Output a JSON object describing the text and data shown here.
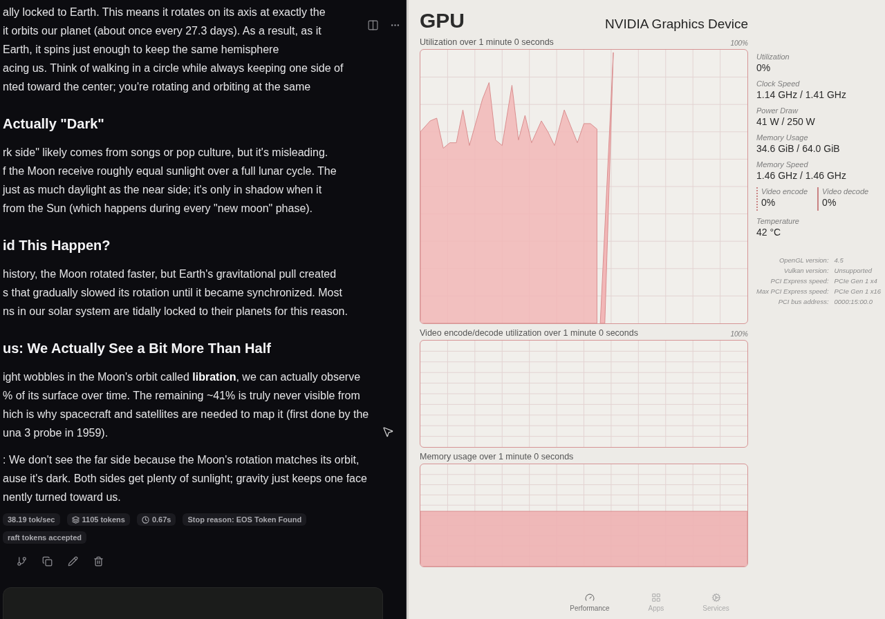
{
  "chat": {
    "blocks": [
      {
        "kind": "paragraph",
        "lines": [
          "ally locked to Earth. This means it rotates on its axis at exactly the",
          "it orbits our planet (about once every 27.3 days). As a result, as it",
          "Earth, it spins just enough to keep the same hemisphere",
          "acing us. Think of walking in a circle while always keeping one side of",
          "nted toward the center; you're rotating and orbiting at the same"
        ]
      },
      {
        "kind": "heading",
        "text": "Actually \"Dark\""
      },
      {
        "kind": "paragraph",
        "lines": [
          "rk side\" likely comes from songs or pop culture, but it's misleading.",
          "f the Moon receive roughly equal sunlight over a full lunar cycle. The",
          "just as much daylight as the near side; it's only in shadow when it",
          "from the Sun (which happens during every \"new moon\" phase)."
        ]
      },
      {
        "kind": "heading",
        "text": "id This Happen?"
      },
      {
        "kind": "paragraph",
        "lines": [
          "history, the Moon rotated faster, but Earth's gravitational pull created",
          "s that gradually slowed its rotation until it became synchronized. Most",
          "ns in our solar system are tidally locked to their planets for this reason."
        ]
      },
      {
        "kind": "heading",
        "text": "us: We Actually See a Bit More Than Half"
      },
      {
        "kind": "paragraph",
        "lines": [
          "ight wobbles in the Moon's orbit called **libration**, we can actually observe",
          "% of its surface over time. The remaining ~41% is truly never visible from",
          "hich is why spacecraft and satellites are needed to map it (first done by the",
          "una 3 probe in 1959)."
        ]
      },
      {
        "kind": "paragraph",
        "lines": [
          ": We don't see the far side because the Moon's rotation matches its orbit,",
          "ause it's dark. Both sides get plenty of sunlight; gravity just keeps one face",
          "nently turned toward us."
        ]
      }
    ],
    "stats": [
      {
        "kind": "speed",
        "text": "38.19 tok/sec"
      },
      {
        "kind": "tokens",
        "text": "1105 tokens"
      },
      {
        "kind": "time",
        "text": "0.67s"
      },
      {
        "kind": "stop",
        "text": "Stop reason: EOS Token Found"
      },
      {
        "kind": "draft",
        "text": "raft tokens accepted"
      }
    ]
  },
  "monitor": {
    "title": "GPU",
    "device": "NVIDIA Graphics Device",
    "charts": [
      {
        "kind": "utilization",
        "title": "Utilization over 1 minute 0 seconds",
        "max_label": "100%"
      },
      {
        "kind": "encode",
        "title": "Video encode/decode utilization over 1 minute 0 seconds",
        "max_label": "100%"
      },
      {
        "kind": "memory",
        "title": "Memory usage over 1 minute 0 seconds"
      }
    ],
    "stats": [
      {
        "label": "Utilization",
        "value": "0%"
      },
      {
        "label": "Clock Speed",
        "value": "1.14 GHz / 1.41 GHz"
      },
      {
        "label": "Power Draw",
        "value": "41 W / 250 W"
      },
      {
        "label": "Memory Usage",
        "value": "34.6 GiB / 64.0 GiB"
      },
      {
        "label": "Memory Speed",
        "value": "1.46 GHz / 1.46 GHz"
      }
    ],
    "video_stats": [
      {
        "kind": "dotted",
        "label": "Video encode",
        "value": "0%"
      },
      {
        "kind": "solid",
        "label": "Video decode",
        "value": "0%"
      }
    ],
    "temperature": {
      "label": "Temperature",
      "value": "42 °C"
    },
    "details": [
      {
        "label": "OpenGL version:",
        "value": "4.5"
      },
      {
        "label": "Vulkan version:",
        "value": "Unsupported"
      },
      {
        "label": "PCI Express speed:",
        "value": "PCIe Gen 1 x4"
      },
      {
        "label": "Max PCI Express speed:",
        "value": "PCIe Gen 1 x16"
      },
      {
        "label": "PCI bus address:",
        "value": "0000:15:00.0"
      }
    ],
    "nav": [
      {
        "kind": "performance",
        "label": "Performance",
        "selected": true
      },
      {
        "kind": "apps",
        "label": "Apps",
        "selected": false
      },
      {
        "kind": "services",
        "label": "Services",
        "selected": false
      }
    ]
  }
}
